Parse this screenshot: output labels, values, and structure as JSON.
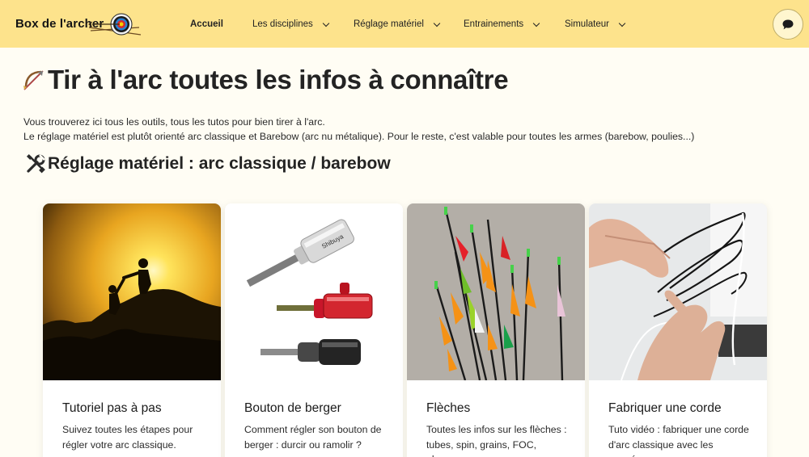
{
  "header": {
    "brand": "Box de l'archer",
    "nav": [
      {
        "label": "Accueil",
        "active": true,
        "dropdown": false
      },
      {
        "label": "Les disciplines",
        "active": false,
        "dropdown": true
      },
      {
        "label": "Réglage matériel",
        "active": false,
        "dropdown": true
      },
      {
        "label": "Entrainements",
        "active": false,
        "dropdown": true
      },
      {
        "label": "Simulateur",
        "active": false,
        "dropdown": true
      }
    ],
    "chat_icon": "chat-bubble-icon"
  },
  "page": {
    "title": "Tir à l'arc toutes les infos à connaître",
    "title_icon": "bow-and-arrow-icon",
    "intro_line1": "Vous trouverez ici tous les outils, tous les tutos pour bien tirer à l'arc.",
    "intro_line2": "Le réglage matériel est plutôt orienté arc classique et Barebow (arc nu métalique). Pour le reste, c'est valable pour toutes les armes (barebow, poulies...)",
    "section_title": "Réglage matériel : arc classique / barebow",
    "section_icon": "tools-icon"
  },
  "cards": [
    {
      "title": "Tutoriel pas à pas",
      "description": "Suivez toutes les étapes pour régler votre arc classique."
    },
    {
      "title": "Bouton de berger",
      "description": "Comment régler son bouton de berger : durcir ou ramolir ?"
    },
    {
      "title": "Flèches",
      "description": "Toutes les infos sur les flèches : tubes, spin, grains, FOC, plumes..."
    },
    {
      "title": "Fabriquer une corde",
      "description": "Tuto vidéo : fabriquer une corde d'arc classique avec les poupées..."
    }
  ],
  "colors": {
    "header_bg": "#fde38c",
    "page_bg": "#fffdf4",
    "card_bg": "#ffffff",
    "text": "#1f1f1f"
  }
}
